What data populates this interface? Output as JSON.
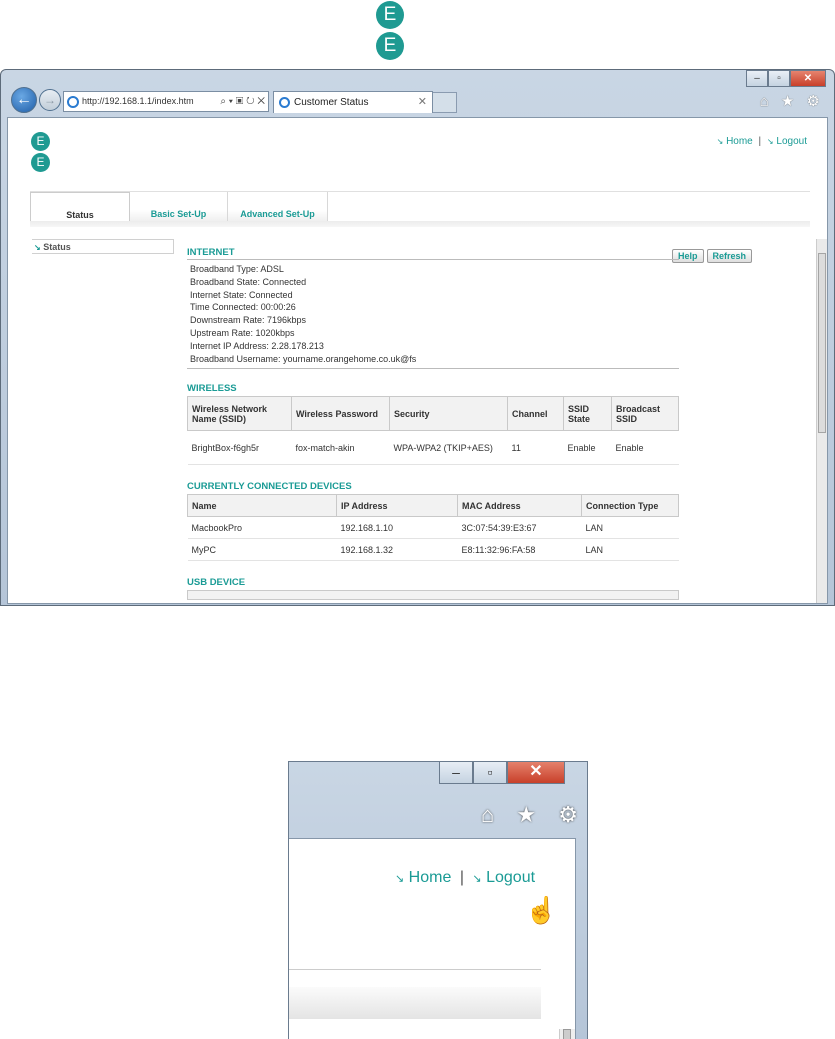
{
  "brand": {
    "logo_top": "E",
    "logo_bottom": "E",
    "accent": "#1a9b95"
  },
  "browser": {
    "url": "http://192.168.1.1/index.htm",
    "address_tools": "⌕ ▾ ▣ ↻ ✕",
    "tab_title": "Customer Status",
    "window_buttons": {
      "minimize": "–",
      "maximize": "▫",
      "close": "✕"
    },
    "toolbar_icons": "⌂ ★ ⚙"
  },
  "header": {
    "home_label": "Home",
    "logout_label": "Logout",
    "separator": "|",
    "arrow": "↘"
  },
  "tabs": [
    {
      "label": "Status"
    },
    {
      "label": "Basic Set-Up"
    },
    {
      "label": "Advanced Set-Up"
    }
  ],
  "sidebar": {
    "items": [
      {
        "label": "Status"
      }
    ]
  },
  "buttons": {
    "help": "Help",
    "refresh": "Refresh"
  },
  "internet": {
    "title": "INTERNET",
    "lines": [
      "Broadband Type: ADSL",
      "Broadband State:  Connected",
      "Internet State:  Connected",
      "Time Connected:  00:00:26",
      "Downstream Rate:  7196kbps",
      "Upstream Rate:  1020kbps",
      "Internet IP Address:  2.28.178.213",
      "Broadband Username:   yourname.orangehome.co.uk@fs"
    ]
  },
  "wireless": {
    "title": "WIRELESS",
    "headers": [
      "Wireless Network Name (SSID)",
      "Wireless Password",
      "Security",
      "Channel",
      "SSID State",
      "Broadcast SSID"
    ],
    "rows": [
      [
        "BrightBox-f6gh5r",
        "fox-match-akin",
        "WPA-WPA2 (TKIP+AES)",
        "11",
        "Enable",
        "Enable"
      ]
    ]
  },
  "devices": {
    "title": "CURRENTLY CONNECTED DEVICES",
    "headers": [
      "Name",
      "IP Address",
      "MAC Address",
      "Connection Type"
    ],
    "rows": [
      [
        "MacbookPro",
        "192.168.1.10",
        "3C:07:54:39:E3:67",
        "LAN"
      ],
      [
        "MyPC",
        "192.168.1.32",
        "E8:11:32:96:FA:58",
        "LAN"
      ]
    ]
  },
  "usb": {
    "title": "USB DEVICE"
  },
  "zoom": {
    "home_label": "Home",
    "logout_label": "Logout",
    "separator": "|"
  }
}
